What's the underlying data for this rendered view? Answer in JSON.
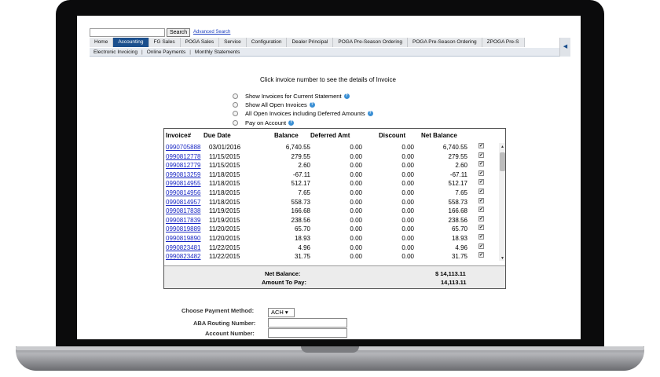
{
  "search": {
    "button_label": "Search",
    "advanced_link": "Advanced Search"
  },
  "tabs": [
    "Home",
    "Accounting",
    "FG Sales",
    "POGA Sales",
    "Service",
    "Configuration",
    "Dealer Principal",
    "POGA Pre-Season Ordering",
    "POGA Pre-Season Ordering",
    "ZPOGA Pre-S"
  ],
  "active_tab": "Accounting",
  "tab_scroll_glyph": "◀",
  "subtabs": [
    "Electronic Invoicing",
    "Online Payments",
    "Monthly Statements"
  ],
  "subtab_separator": "|",
  "instruction": "Click invoice number to see the details of Invoice",
  "options": [
    {
      "label": "Show Invoices for Current Statement",
      "help": true
    },
    {
      "label": "Show All Open Invoices",
      "help": true
    },
    {
      "label": "All Open Invoices including Deferred Amounts",
      "help": true
    },
    {
      "label": "Pay on Account",
      "help": true
    }
  ],
  "help_glyph": "?",
  "checkbox_glyph": "✔",
  "table": {
    "headers": {
      "invoice": "Invoice#",
      "due": "Due Date",
      "balance": "Balance",
      "deferred": "Deferred Amt",
      "discount": "Discount",
      "net": "Net Balance"
    },
    "rows": [
      {
        "invoice": "0990705888",
        "due": "03/01/2016",
        "balance": "6,740.55",
        "deferred": "0.00",
        "discount": "0.00",
        "net": "6,740.55"
      },
      {
        "invoice": "0990812778",
        "due": "11/15/2015",
        "balance": "279.55",
        "deferred": "0.00",
        "discount": "0.00",
        "net": "279.55"
      },
      {
        "invoice": "0990812779",
        "due": "11/15/2015",
        "balance": "2.60",
        "deferred": "0.00",
        "discount": "0.00",
        "net": "2.60"
      },
      {
        "invoice": "0990813259",
        "due": "11/18/2015",
        "balance": "-67.11",
        "deferred": "0.00",
        "discount": "0.00",
        "net": "-67.11"
      },
      {
        "invoice": "0990814955",
        "due": "11/18/2015",
        "balance": "512.17",
        "deferred": "0.00",
        "discount": "0.00",
        "net": "512.17"
      },
      {
        "invoice": "0990814956",
        "due": "11/18/2015",
        "balance": "7.65",
        "deferred": "0.00",
        "discount": "0.00",
        "net": "7.65"
      },
      {
        "invoice": "0990814957",
        "due": "11/18/2015",
        "balance": "558.73",
        "deferred": "0.00",
        "discount": "0.00",
        "net": "558.73"
      },
      {
        "invoice": "0990817838",
        "due": "11/19/2015",
        "balance": "166.68",
        "deferred": "0.00",
        "discount": "0.00",
        "net": "166.68"
      },
      {
        "invoice": "0990817839",
        "due": "11/19/2015",
        "balance": "238.56",
        "deferred": "0.00",
        "discount": "0.00",
        "net": "238.56"
      },
      {
        "invoice": "0990819889",
        "due": "11/20/2015",
        "balance": "65.70",
        "deferred": "0.00",
        "discount": "0.00",
        "net": "65.70"
      },
      {
        "invoice": "0990819890",
        "due": "11/20/2015",
        "balance": "18.93",
        "deferred": "0.00",
        "discount": "0.00",
        "net": "18.93"
      },
      {
        "invoice": "0990823481",
        "due": "11/22/2015",
        "balance": "4.96",
        "deferred": "0.00",
        "discount": "0.00",
        "net": "4.96"
      },
      {
        "invoice": "0990823482",
        "due": "11/22/2015",
        "balance": "31.75",
        "deferred": "0.00",
        "discount": "0.00",
        "net": "31.75"
      }
    ],
    "net_balance_label": "Net Balance:",
    "net_balance_value": "$ 14,113.11",
    "amount_to_pay_label": "Amount To Pay:",
    "amount_to_pay_value": "14,113.11"
  },
  "scroll_glyphs": {
    "up": "▲",
    "down": "▼"
  },
  "payment": {
    "method_label": "Choose Payment Method:",
    "method_value": "ACH ▾",
    "routing_label": "ABA Routing Number:",
    "account_label": "Account Number:"
  }
}
